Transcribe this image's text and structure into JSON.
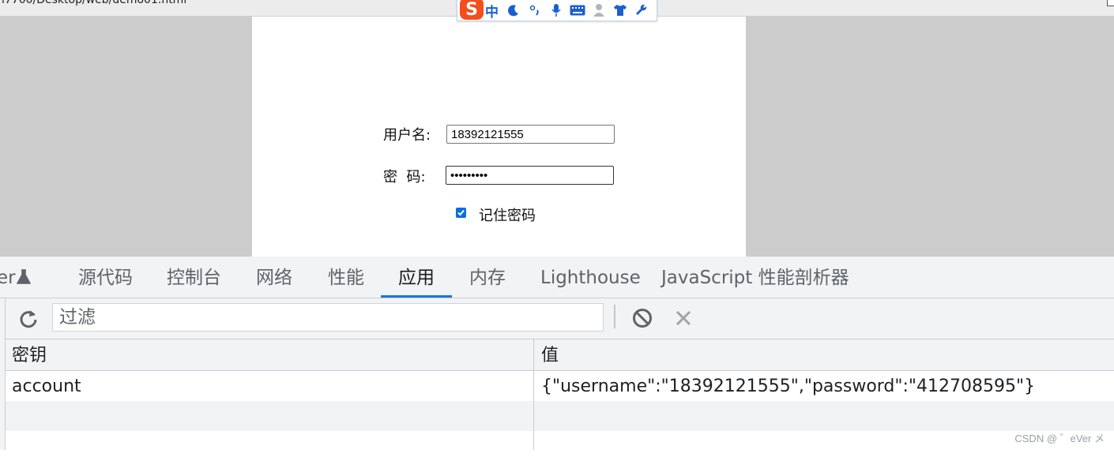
{
  "browser": {
    "url_fragment": "l7700/Desktop/web/demo01.html"
  },
  "ime": {
    "mode": "中"
  },
  "form": {
    "username_label": "用户名:",
    "username_value": "18392121555",
    "password_label": "密  码:",
    "password_masked": "•••••••••",
    "remember_label": "记住密码",
    "remember_checked": true
  },
  "devtools": {
    "tabs": [
      {
        "label": "er"
      },
      {
        "label": "源代码"
      },
      {
        "label": "控制台"
      },
      {
        "label": "网络"
      },
      {
        "label": "性能"
      },
      {
        "label": "应用"
      },
      {
        "label": "内存"
      },
      {
        "label": "Lighthouse"
      },
      {
        "label": "JavaScript 性能剖析器"
      }
    ],
    "active_tab": "应用",
    "filter_placeholder": "过滤",
    "table": {
      "columns": [
        "密钥",
        "值"
      ],
      "rows": [
        {
          "key": "account",
          "value": "{\"username\":\"18392121555\",\"password\":\"412708595\"}"
        }
      ]
    }
  },
  "colors": {
    "accent": "#1a73e8",
    "checkbox": "#0a6ee6",
    "ime_logo": "#f24f1c"
  },
  "watermark": "CSDN @ ゛eVer メ"
}
